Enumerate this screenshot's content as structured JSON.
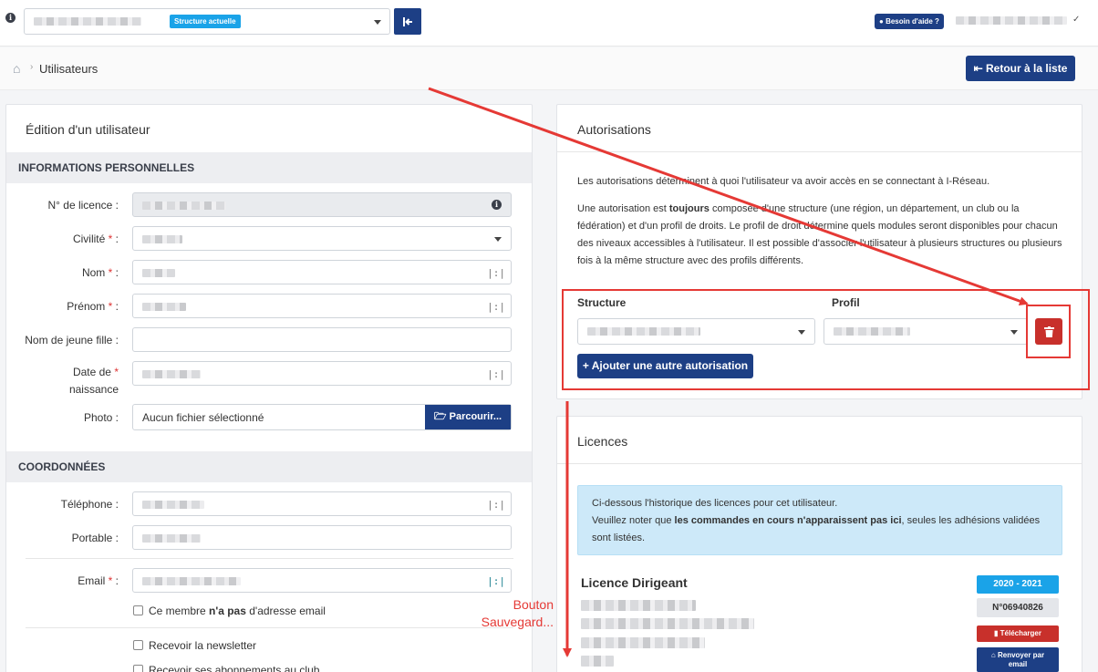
{
  "header": {
    "structure_badge": "Structure actuelle",
    "help_label": "Besoin d'aide ?"
  },
  "breadcrumb": {
    "title": "Utilisateurs",
    "back_button": "Retour à la liste"
  },
  "edit_card": {
    "title": "Édition d'un utilisateur",
    "personal_section": "INFORMATIONS PERSONNELLES",
    "fields": {
      "licence": "N° de licence :",
      "civilite": "Civilité",
      "nom": "Nom",
      "prenom": "Prénom",
      "nom_jeune_fille": "Nom de jeune fille :",
      "date_naissance_1": "Date de",
      "date_naissance_2": "naissance",
      "photo": "Photo :"
    },
    "required_mark": "*",
    "colon": " :",
    "file": {
      "placeholder": "Aucun fichier sélectionné",
      "browse": "Parcourir..."
    },
    "contact_section": "COORDONNÉES",
    "contact_fields": {
      "telephone": "Téléphone :",
      "portable": "Portable :",
      "email": "Email"
    },
    "no_email_prefix": "Ce membre ",
    "no_email_bold": "n'a pas",
    "no_email_suffix": " d'adresse email",
    "newsletter": "Recevoir la newsletter",
    "club_subscriptions": "Recevoir ses abonnements au club"
  },
  "auth_card": {
    "title": "Autorisations",
    "intro": "Les autorisations déterminent à quoi l'utilisateur va avoir accès en se connectant à I-Réseau.",
    "detail_prefix": "Une autorisation est ",
    "detail_bold": "toujours",
    "detail_suffix": " composée d'une structure (une région, un département, un club ou la fédération) et d'un profil de droits. Le profil de droit détermine quels modules seront disponibles pour chacun des niveaux accessibles à l'utilisateur. Il est possible d'associer l'utilisateur à plusieurs structures ou plusieurs fois à la même structure avec des profils différents.",
    "col_structure": "Structure",
    "col_profil": "Profil",
    "add_button": "Ajouter une autre autorisation"
  },
  "licences_card": {
    "title": "Licences",
    "info_line1": "Ci-dessous l'historique des licences pour cet utilisateur.",
    "info_line2_prefix": "Veuillez noter que ",
    "info_line2_bold": "les commandes en cours n'apparaissent pas ici",
    "info_line2_suffix": ", seules les adhésions validées sont listées.",
    "licence_name": "Licence Dirigeant",
    "season": "2020 - 2021",
    "number": "N°06940826",
    "download": "Télécharger",
    "resend_1": "Renvoyer par",
    "resend_2": "email"
  },
  "annotation": {
    "line1": "Bouton",
    "line2": "Sauvegard..."
  },
  "colors": {
    "primary": "#1d3f85",
    "info": "#1aa3e8",
    "danger": "#c8302b",
    "annotation": "#e53935"
  }
}
